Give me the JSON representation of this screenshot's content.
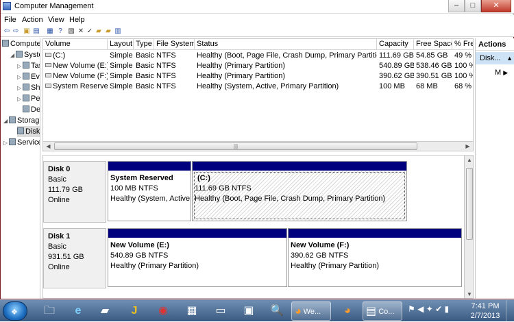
{
  "window": {
    "title": "Computer Management"
  },
  "menu": [
    "File",
    "Action",
    "View",
    "Help"
  ],
  "tree": [
    {
      "label": "Compute",
      "expander": "",
      "indent": 0
    },
    {
      "label": "System",
      "expander": "◢",
      "indent": 1
    },
    {
      "label": "Task",
      "expander": "▷",
      "indent": 2
    },
    {
      "label": "Ever",
      "expander": "▷",
      "indent": 2
    },
    {
      "label": "Shar",
      "expander": "▷",
      "indent": 2
    },
    {
      "label": "Perfo",
      "expander": "▷",
      "indent": 2
    },
    {
      "label": "Devi",
      "expander": "",
      "indent": 2
    },
    {
      "label": "Storag",
      "expander": "◢",
      "indent": 1
    },
    {
      "label": "Disk",
      "expander": "",
      "indent": 2
    },
    {
      "label": "Service",
      "expander": "▷",
      "indent": 1
    }
  ],
  "columns": [
    "Volume",
    "Layout",
    "Type",
    "File System",
    "Status",
    "Capacity",
    "Free Space",
    "% Fre"
  ],
  "volumes": [
    {
      "volume": "(C:)",
      "layout": "Simple",
      "type": "Basic",
      "fs": "NTFS",
      "status": "Healthy (Boot, Page File, Crash Dump, Primary Partition)",
      "capacity": "111.69 GB",
      "free": "54.85 GB",
      "pct": "49 %"
    },
    {
      "volume": "New Volume (E:)",
      "layout": "Simple",
      "type": "Basic",
      "fs": "NTFS",
      "status": "Healthy (Primary Partition)",
      "capacity": "540.89 GB",
      "free": "538.46 GB",
      "pct": "100 %"
    },
    {
      "volume": "New Volume (F:)",
      "layout": "Simple",
      "type": "Basic",
      "fs": "NTFS",
      "status": "Healthy (Primary Partition)",
      "capacity": "390.62 GB",
      "free": "390.51 GB",
      "pct": "100 %"
    },
    {
      "volume": "System Reserved",
      "layout": "Simple",
      "type": "Basic",
      "fs": "NTFS",
      "status": "Healthy (System, Active, Primary Partition)",
      "capacity": "100 MB",
      "free": "68 MB",
      "pct": "68 %"
    }
  ],
  "disks": [
    {
      "name": "Disk 0",
      "type": "Basic",
      "size": "111.79 GB",
      "state": "Online",
      "partitions": [
        {
          "label": "System Reserved",
          "size": "100 MB NTFS",
          "status": "Healthy (System, Active,"
        },
        {
          "label": "(C:)",
          "size": "111.69 GB NTFS",
          "status": "Healthy (Boot, Page File, Crash Dump, Primary Partition)"
        }
      ]
    },
    {
      "name": "Disk 1",
      "type": "Basic",
      "size": "931.51 GB",
      "state": "Online",
      "partitions": [
        {
          "label": "New Volume  (E:)",
          "size": "540.89 GB NTFS",
          "status": "Healthy (Primary Partition)"
        },
        {
          "label": "New Volume  (F:)",
          "size": "390.62 GB NTFS",
          "status": "Healthy (Primary Partition)"
        }
      ]
    }
  ],
  "actions": {
    "header": "Actions",
    "selected": "Disk...",
    "more": "M"
  },
  "taskbar": {
    "items": [
      {
        "name": "explorer-icon",
        "glyph": "🗀",
        "label": ""
      },
      {
        "name": "internet-explorer-icon",
        "glyph": "e",
        "label": ""
      },
      {
        "name": "app-icon",
        "glyph": "▰",
        "label": ""
      },
      {
        "name": "app-icon-j",
        "glyph": "J",
        "label": ""
      },
      {
        "name": "app-icon-red",
        "glyph": "◉",
        "label": ""
      },
      {
        "name": "paint-icon",
        "glyph": "▦",
        "label": ""
      },
      {
        "name": "cmd-icon",
        "glyph": "▭",
        "label": ""
      },
      {
        "name": "monitor-icon",
        "glyph": "▣",
        "label": ""
      },
      {
        "name": "search-file-icon",
        "glyph": "🔍",
        "label": ""
      },
      {
        "name": "firefox-icon",
        "glyph": "◕",
        "label": "We..."
      },
      {
        "name": "firefox-icon-2",
        "glyph": "◕",
        "label": ""
      },
      {
        "name": "computer-management-icon",
        "glyph": "▤",
        "label": "Co..."
      }
    ],
    "time": "7:41 PM",
    "date": "2/7/2013"
  }
}
